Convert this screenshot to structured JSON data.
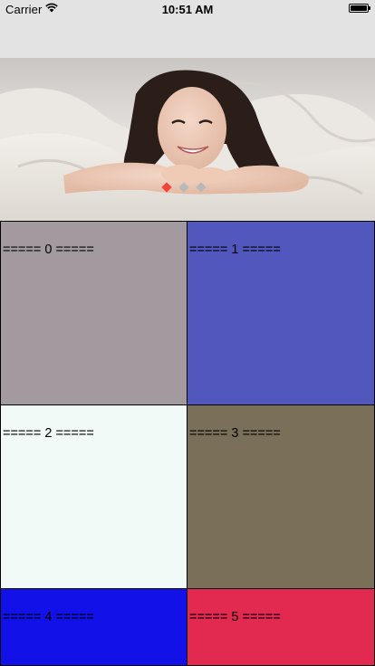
{
  "status_bar": {
    "carrier": "Carrier",
    "time": "10:51 AM",
    "wifi_icon": "wifi-icon",
    "battery_icon": "battery-icon"
  },
  "banner": {
    "image": "portrait-photo",
    "dots": {
      "count": 3,
      "active_index": 0,
      "active_color": "#f2443b",
      "inactive_color": "#b8b8b8"
    }
  },
  "cells": [
    {
      "label": "===== 0 =====",
      "color": "#a29a9f"
    },
    {
      "label": "===== 1 =====",
      "color": "#5257be"
    },
    {
      "label": "===== 2 =====",
      "color": "#f2faf7"
    },
    {
      "label": "===== 3 =====",
      "color": "#7a6f59"
    },
    {
      "label": "===== 4 =====",
      "color": "#1212e8"
    },
    {
      "label": "===== 5 =====",
      "color": "#e22a51"
    }
  ]
}
